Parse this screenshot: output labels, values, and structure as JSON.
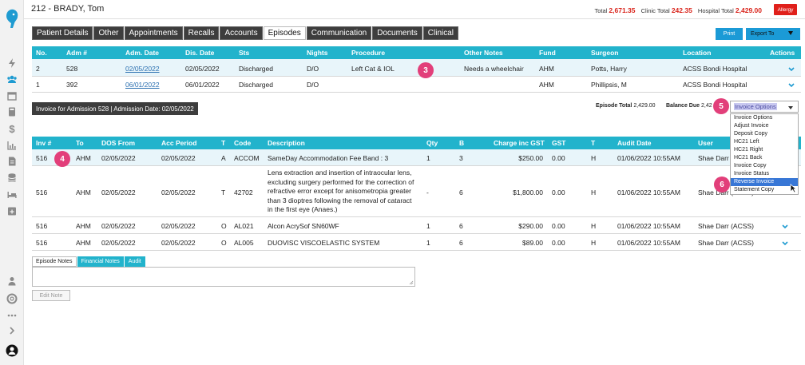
{
  "header": {
    "patient_name": "212 - BRADY, Tom",
    "total_label": "Total",
    "total_value": "2,671.35",
    "clinic_total_label": "Clinic Total",
    "clinic_total_value": "242.35",
    "hospital_total_label": "Hospital Total",
    "hospital_total_value": "2,429.00",
    "allergy_label": "Allergy"
  },
  "tabs": [
    {
      "label": "Patient Details",
      "active": false
    },
    {
      "label": "Other",
      "active": false
    },
    {
      "label": "Appointments",
      "active": false
    },
    {
      "label": "Recalls",
      "active": false
    },
    {
      "label": "Accounts",
      "active": false
    },
    {
      "label": "Episodes",
      "active": true
    },
    {
      "label": "Communication",
      "active": false
    },
    {
      "label": "Documents",
      "active": false
    },
    {
      "label": "Clinical",
      "active": false
    }
  ],
  "toolbar": {
    "print_label": "Print",
    "export_label": "Export To"
  },
  "episodes": {
    "columns": [
      "No.",
      "Adm #",
      "Adm. Date",
      "Dis. Date",
      "Sts",
      "Nights",
      "Procedure",
      "Other Notes",
      "Fund",
      "Surgeon",
      "Location",
      "Actions"
    ],
    "rows": [
      {
        "no": "2",
        "adm": "528",
        "adm_date": "02/05/2022",
        "dis_date": "02/05/2022",
        "sts": "Discharged",
        "nights": "D/O",
        "procedure": "Left Cat & IOL",
        "other_notes": "Needs a wheelchair",
        "fund": "AHM",
        "surgeon": "Potts, Harry",
        "location": "ACSS Bondi Hospital"
      },
      {
        "no": "1",
        "adm": "392",
        "adm_date": "06/01/2022",
        "dis_date": "06/01/2022",
        "sts": "Discharged",
        "nights": "D/O",
        "procedure": "",
        "other_notes": "",
        "fund": "AHM",
        "surgeon": "Phillipsis, M",
        "location": "ACSS Bondi Hospital"
      }
    ]
  },
  "invoice": {
    "title": "Invoice for Admission  528 | Admission Date: 02/05/2022",
    "episode_total_label": "Episode Total",
    "episode_total_value": "2,429.00",
    "balance_due_label": "Balance Due",
    "balance_due_value": "2,42",
    "options_selected": "Invoice Options",
    "options": [
      "Invoice Options",
      "Adjust Invoice",
      "Deposit Copy",
      "HC21 Left",
      "HC21 Right",
      "HC21 Back",
      "Invoice Copy",
      "Invoice Status",
      "Reverse Invoice",
      "Statement Copy"
    ],
    "highlighted_option": "Reverse Invoice"
  },
  "invoice_lines": {
    "columns": [
      "Inv #",
      "To",
      "DOS From",
      "Acc Period",
      "T",
      "Code",
      "Description",
      "Qty",
      "B",
      "Charge inc GST",
      "GST",
      "T",
      "Audit Date",
      "User"
    ],
    "rows": [
      {
        "inv": "516",
        "to": "AHM",
        "dos": "02/05/2022",
        "acc": "02/05/2022",
        "t": "A",
        "code": "ACCOM",
        "desc": [
          "SameDay Accommodation Fee Band : 3"
        ],
        "qty": "1",
        "b": "3",
        "charge": "$250.00",
        "gst": "0.00",
        "t2": "H",
        "audit": "01/06/2022 10:55AM",
        "user": "Shae Darr (ACSS)"
      },
      {
        "inv": "516",
        "to": "AHM",
        "dos": "02/05/2022",
        "acc": "02/05/2022",
        "t": "T",
        "code": "42702",
        "desc": [
          "Lens extraction and insertion of intraocular lens,",
          "excluding surgery performed for the correction of",
          "refractive error except for anisometropia greater",
          "than 3 dioptres following the removal of cataract",
          "in the first eye (Anaes.)"
        ],
        "qty": "-",
        "b": "6",
        "charge": "$1,800.00",
        "gst": "0.00",
        "t2": "H",
        "audit": "01/06/2022 10:55AM",
        "user": "Shae Darr (ACSS)"
      },
      {
        "inv": "516",
        "to": "AHM",
        "dos": "02/05/2022",
        "acc": "02/05/2022",
        "t": "O",
        "code": "AL021",
        "desc": [
          "Alcon AcrySof SN60WF"
        ],
        "qty": "1",
        "b": "6",
        "charge": "$290.00",
        "gst": "0.00",
        "t2": "H",
        "audit": "01/06/2022 10:55AM",
        "user": "Shae Darr (ACSS)"
      },
      {
        "inv": "516",
        "to": "AHM",
        "dos": "02/05/2022",
        "acc": "02/05/2022",
        "t": "O",
        "code": "AL005",
        "desc": [
          "DUOVISC VISCOELASTIC SYSTEM"
        ],
        "qty": "1",
        "b": "6",
        "charge": "$89.00",
        "gst": "0.00",
        "t2": "H",
        "audit": "01/06/2022 10:55AM",
        "user": "Shae Darr (ACSS)"
      }
    ]
  },
  "notes": {
    "tabs": [
      "Episode Notes",
      "Financial Notes",
      "Audit"
    ],
    "edit_label": "Edit Note"
  },
  "badges": [
    "3",
    "4",
    "5",
    "6"
  ],
  "colors": {
    "accent": "#22b3cc",
    "tab_dark": "#3d3d3d",
    "alert": "#e0201b",
    "badge": "#e23f7a",
    "button": "#1b9ad6"
  },
  "sidebar_icons": [
    "lightning-icon",
    "users-icon",
    "calendar-icon",
    "calculator-icon",
    "dollar-icon",
    "chart-icon",
    "document-icon",
    "database-icon",
    "bed-icon",
    "calendar-plus-icon",
    "person-icon",
    "help-icon",
    "more-icon",
    "chevron-right-icon",
    "profile-icon"
  ]
}
